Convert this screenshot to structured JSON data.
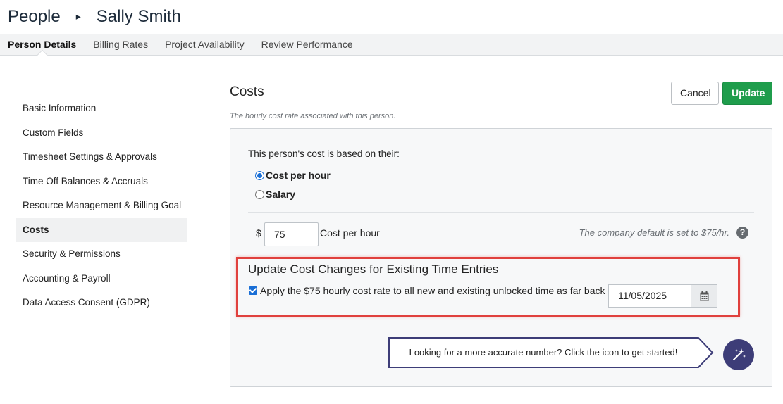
{
  "breadcrumb": {
    "root": "People",
    "separator": "▸",
    "current": "Sally Smith"
  },
  "tabs": [
    {
      "label": "Person Details",
      "active": true
    },
    {
      "label": "Billing Rates",
      "active": false
    },
    {
      "label": "Project Availability",
      "active": false
    },
    {
      "label": "Review Performance",
      "active": false
    }
  ],
  "sidebar": {
    "items": [
      {
        "label": "Basic Information"
      },
      {
        "label": "Custom Fields"
      },
      {
        "label": "Timesheet Settings & Approvals"
      },
      {
        "label": "Time Off Balances & Accruals"
      },
      {
        "label": "Resource Management & Billing Goal"
      },
      {
        "label": "Costs",
        "active": true
      },
      {
        "label": "Security & Permissions"
      },
      {
        "label": "Accounting & Payroll"
      },
      {
        "label": "Data Access Consent (GDPR)"
      }
    ]
  },
  "costs": {
    "title": "Costs",
    "subtitle": "The hourly cost rate associated with this person.",
    "cancel_label": "Cancel",
    "update_label": "Update",
    "basis_label": "This person's cost is based on their:",
    "options": [
      {
        "label": "Cost per hour",
        "selected": true
      },
      {
        "label": "Salary",
        "selected": false
      }
    ],
    "currency_symbol": "$",
    "cost_value": "75",
    "cost_unit": "Cost per hour",
    "default_note": "The company default is set to $75/hr.",
    "help_icon": "?"
  },
  "update_changes": {
    "title": "Update Cost Changes for Existing Time Entries",
    "apply_label": "Apply the $75 hourly cost rate to all new and existing unlocked time as far back as",
    "apply_checked": true,
    "date_value": "11/05/2025"
  },
  "callout": {
    "text": "Looking for a more accurate number? Click the icon to get started!"
  },
  "colors": {
    "accent_green": "#1f9d4c",
    "highlight_red": "#e0403d",
    "wand_button": "#3d3d78",
    "radio_blue": "#1a6fd6"
  }
}
